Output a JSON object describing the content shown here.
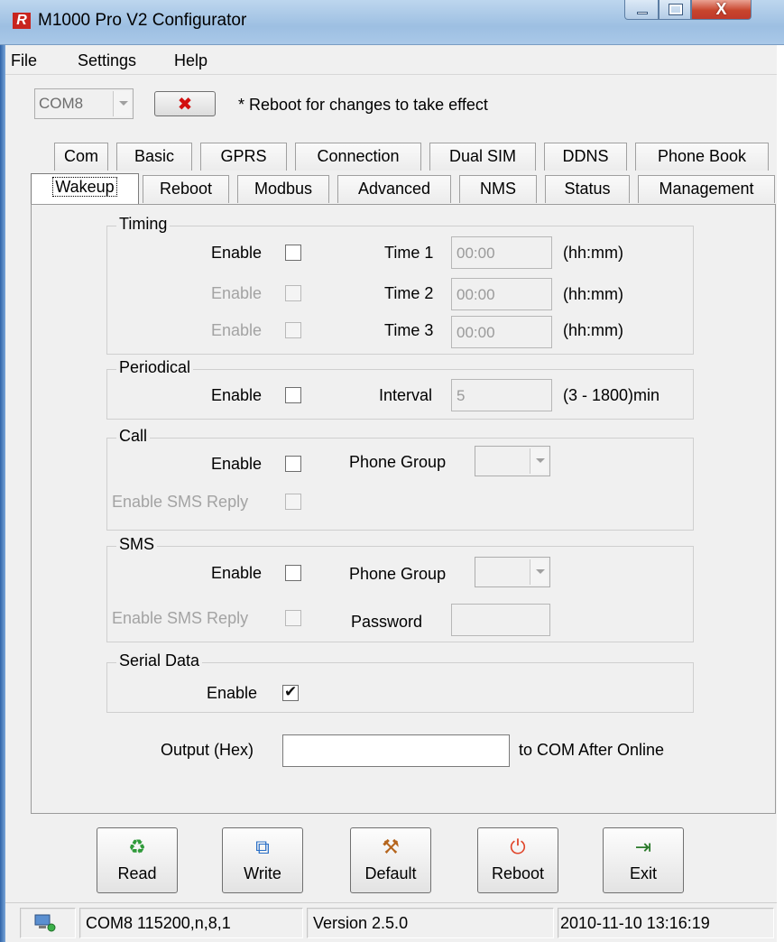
{
  "window": {
    "title": "M1000 Pro V2 Configurator",
    "app_icon_letter": "R"
  },
  "menu": {
    "items": [
      "File",
      "Settings",
      "Help"
    ]
  },
  "toolbar": {
    "com_port": "COM8",
    "disconnect_glyph": "✖",
    "note": "* Reboot for changes to take effect"
  },
  "tabs": {
    "row1": [
      "Com",
      "Basic",
      "GPRS",
      "Connection",
      "Dual SIM",
      "DDNS",
      "Phone Book"
    ],
    "row2": [
      "Wakeup",
      "Reboot",
      "Modbus",
      "Advanced",
      "NMS",
      "Status",
      "Management"
    ],
    "active": "Wakeup"
  },
  "timing": {
    "title": "Timing",
    "rows": [
      {
        "enable_label": "Enable",
        "enabled": true,
        "checked": false,
        "time_label": "Time 1",
        "time_value": "00:00",
        "unit": "(hh:mm)"
      },
      {
        "enable_label": "Enable",
        "enabled": false,
        "checked": false,
        "time_label": "Time 2",
        "time_value": "00:00",
        "unit": "(hh:mm)"
      },
      {
        "enable_label": "Enable",
        "enabled": false,
        "checked": false,
        "time_label": "Time 3",
        "time_value": "00:00",
        "unit": "(hh:mm)"
      }
    ]
  },
  "periodical": {
    "title": "Periodical",
    "enable_label": "Enable",
    "checked": false,
    "interval_label": "Interval",
    "interval_value": "5",
    "range": "(3 - 1800)min"
  },
  "call": {
    "title": "Call",
    "enable_label": "Enable",
    "checked": false,
    "phone_group_label": "Phone Group",
    "phone_group_value": "",
    "sms_reply_label": "Enable SMS Reply",
    "sms_reply_checked": false
  },
  "sms": {
    "title": "SMS",
    "enable_label": "Enable",
    "checked": false,
    "phone_group_label": "Phone Group",
    "phone_group_value": "",
    "sms_reply_label": "Enable SMS Reply",
    "sms_reply_checked": false,
    "password_label": "Password",
    "password_value": ""
  },
  "serial_data": {
    "title": "Serial Data",
    "enable_label": "Enable",
    "checked": true,
    "check_glyph": "✔"
  },
  "output": {
    "label": "Output (Hex)",
    "value": "",
    "suffix": "to COM After Online"
  },
  "buttons": [
    {
      "label": "Read",
      "icon": "recycle-icon",
      "glyph": "♻",
      "color": "#2f9a3a"
    },
    {
      "label": "Write",
      "icon": "windows-icon",
      "glyph": "⧉",
      "color": "#2a6fc6"
    },
    {
      "label": "Default",
      "icon": "tools-icon",
      "glyph": "⚒",
      "color": "#b5651d"
    },
    {
      "label": "Reboot",
      "icon": "power-icon",
      "glyph": "⏻",
      "color": "#e0452a"
    },
    {
      "label": "Exit",
      "icon": "exit-door-icon",
      "glyph": "⇥",
      "color": "#2b7a2b"
    }
  ],
  "status": {
    "port": "COM8 115200,n,8,1",
    "version": "Version 2.5.0",
    "datetime": "2010-11-10 13:16:19"
  }
}
